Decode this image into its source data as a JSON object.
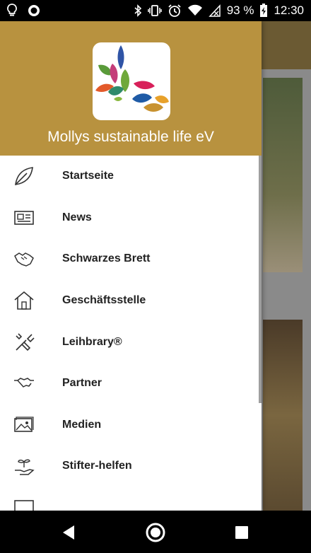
{
  "status_bar": {
    "battery_percent": "93 %",
    "time": "12:30",
    "icons": [
      "bulb-icon",
      "record-icon",
      "bluetooth-icon",
      "vibrate-icon",
      "alarm-icon",
      "wifi-icon",
      "signal-icon",
      "battery-charging-icon"
    ]
  },
  "drawer": {
    "header": {
      "title": "Mollys sustainable life eV",
      "background_color": "#b8923f"
    },
    "items": [
      {
        "label": "Startseite",
        "icon": "leaf-icon"
      },
      {
        "label": "News",
        "icon": "newspaper-icon"
      },
      {
        "label": "Schwarzes Brett",
        "icon": "handshake-icon"
      },
      {
        "label": "Geschäftsstelle",
        "icon": "home-icon"
      },
      {
        "label": "Leihbrary®",
        "icon": "tools-icon"
      },
      {
        "label": "Partner",
        "icon": "partner-handshake-icon"
      },
      {
        "label": "Medien",
        "icon": "image-gallery-icon"
      },
      {
        "label": "Stifter-helfen",
        "icon": "plant-hand-icon"
      }
    ]
  },
  "nav_bar": {
    "icons": [
      "back-icon",
      "home-circle-icon",
      "recents-icon"
    ]
  }
}
